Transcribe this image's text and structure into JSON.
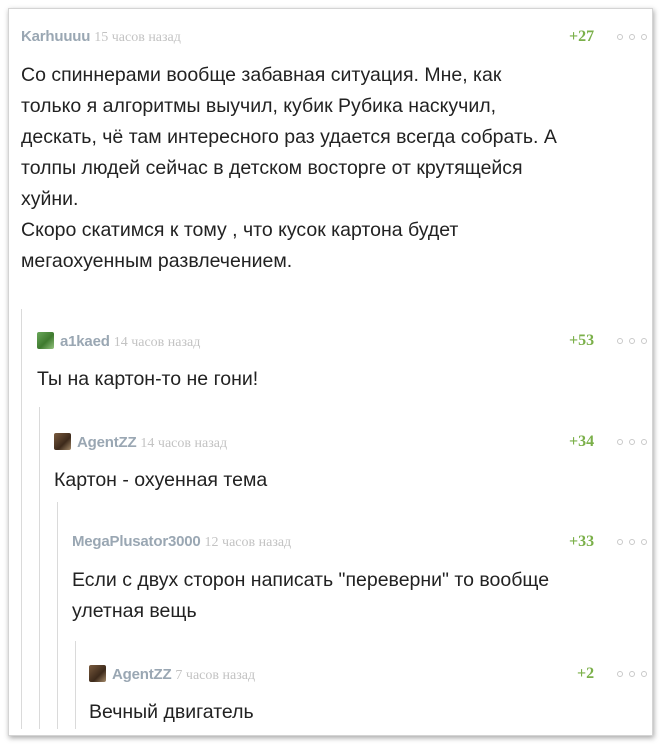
{
  "comments": [
    {
      "author": "Karhuuuu",
      "time": "15 часов назад",
      "rating": "+27",
      "text": "Со спиннерами вообще забавная ситуация. Мне, как\nтолько я алгоритмы выучил, кубик Рубика наскучил,\nдескать, чё там интересного раз удается всегда собрать. А\nтолпы людей сейчас в детском восторге от крутящейся\nхуйни.\nСкоро скатимся к тому , что кусок картона будет\nмегаохуенным развлечением."
    },
    {
      "author": "a1kaed",
      "time": "14 часов назад",
      "rating": "+53",
      "avatar": "avatar-green",
      "text": "Ты на картон-то не гони!"
    },
    {
      "author": "AgentZZ",
      "time": "14 часов назад",
      "rating": "+34",
      "avatar": "avatar-brown",
      "text": "Картон - охуенная тема"
    },
    {
      "author": "MegaPlusator3000",
      "time": "12 часов назад",
      "rating": "+33",
      "text": "Если с двух сторон написать \"переверни\" то вообще\nулетная вещь"
    },
    {
      "author": "AgentZZ",
      "time": "7 часов назад",
      "rating": "+2",
      "avatar": "avatar-brown",
      "text": "Вечный двигатель"
    }
  ],
  "icons": {
    "more": "more-dots-icon"
  },
  "colors": {
    "author": "#9aa7b3",
    "rating": "#7bb04a",
    "time": "#c3c3c3",
    "text": "#222222"
  }
}
